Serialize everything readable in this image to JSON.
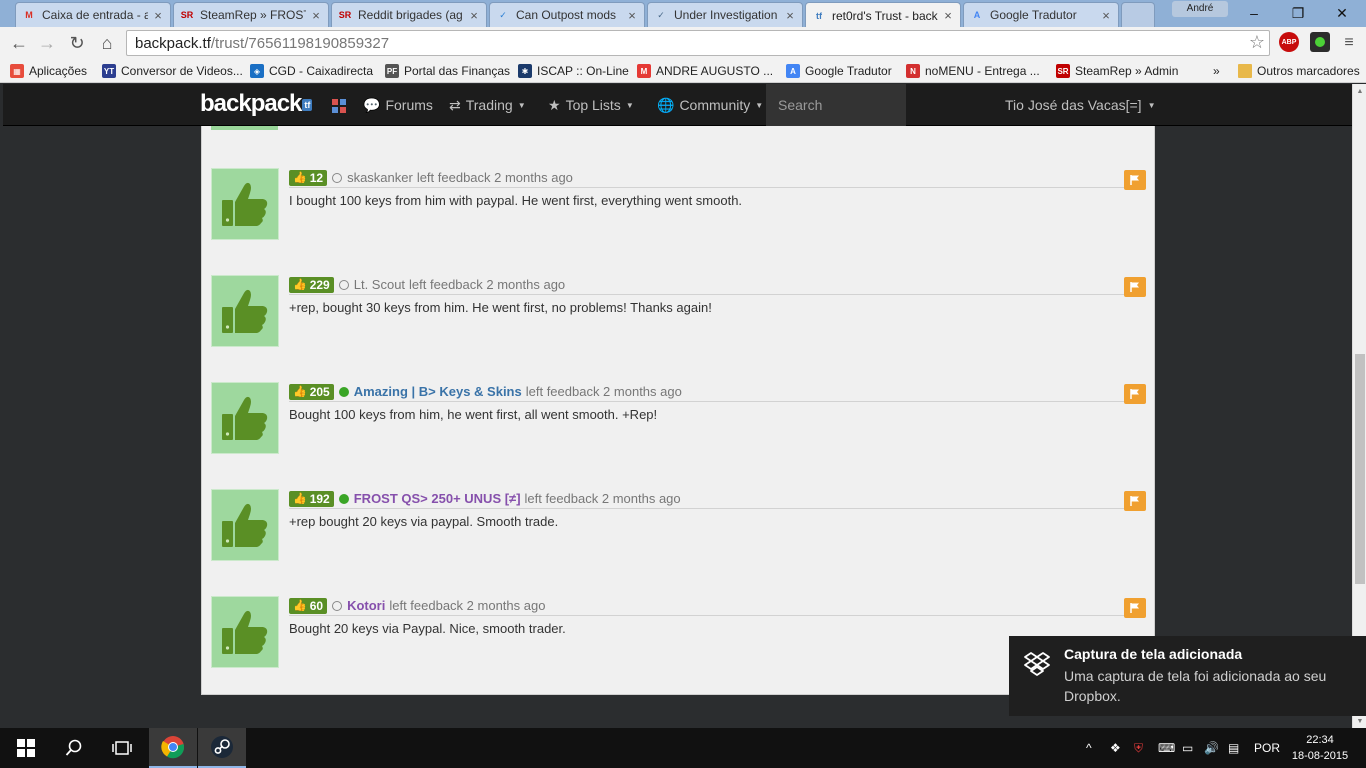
{
  "browser": {
    "tabs": [
      {
        "label": "Caixa de entrada - a",
        "icon": "gmail-icon",
        "fav": "M",
        "color": "#d93025"
      },
      {
        "label": "SteamRep » FROST",
        "icon": "steamrep-icon",
        "fav": "SR",
        "color": "#c00000"
      },
      {
        "label": "Reddit brigades (ag",
        "icon": "steamrep-icon",
        "fav": "SR",
        "color": "#c00000"
      },
      {
        "label": "Can Outpost mods",
        "icon": "outpost-icon",
        "fav": "✓",
        "color": "#2b7fd4"
      },
      {
        "label": "Under Investigation",
        "icon": "outpost-icon",
        "fav": "✓",
        "color": "#4a6a8a"
      },
      {
        "label": "ret0rd's Trust - back",
        "icon": "backpack-icon",
        "fav": "tf",
        "color": "#3e7cbf",
        "active": true
      },
      {
        "label": "Google Tradutor",
        "icon": "google-translate-icon",
        "fav": "A",
        "color": "#4285f4"
      }
    ],
    "profile_name": "André",
    "url_host": "backpack.tf",
    "url_path": "/trust/76561198190859327",
    "extensions": [
      {
        "label": "ABP",
        "color": "#c70d0d"
      },
      {
        "label": "",
        "color": "#2c2c2c"
      }
    ],
    "bookmarks": [
      {
        "label": "Aplicações",
        "icon": "apps-icon",
        "fav": "▦",
        "color": "#e74c3c"
      },
      {
        "label": "Conversor de Videos...",
        "icon": "mp3-icon",
        "fav": "YT",
        "color": "#2c3e90"
      },
      {
        "label": "CGD - Caixadirecta",
        "icon": "cgd-icon",
        "fav": "◈",
        "color": "#1a6fc4"
      },
      {
        "label": "Portal das Finanças",
        "icon": "financas-icon",
        "fav": "PF",
        "color": "#555555"
      },
      {
        "label": "ISCAP :: On-Line",
        "icon": "iscap-icon",
        "fav": "✱",
        "color": "#1b3a6b"
      },
      {
        "label": "ANDRE AUGUSTO ...",
        "icon": "m-icon",
        "fav": "M",
        "color": "#e53935"
      },
      {
        "label": "Google Tradutor",
        "icon": "google-translate-icon",
        "fav": "A",
        "color": "#4285f4"
      },
      {
        "label": "noMENU - Entrega ...",
        "icon": "nomenu-icon",
        "fav": "N",
        "color": "#d32f2f"
      },
      {
        "label": "SteamRep » Admin",
        "icon": "steamrep-icon",
        "fav": "SR",
        "color": "#c00000"
      }
    ],
    "bookmarks_overflow": "»",
    "other_bookmarks": "Outros marcadores"
  },
  "site": {
    "logo": "backpack",
    "logo_badge": "tf",
    "nav": [
      {
        "label": "Forums",
        "icon": "chat-icon",
        "glyph": "💬",
        "caret": false
      },
      {
        "label": "Trading",
        "icon": "exchange-icon",
        "glyph": "⇄",
        "caret": true
      },
      {
        "label": "Top Lists",
        "icon": "star-icon",
        "glyph": "★",
        "caret": true
      },
      {
        "label": "Community",
        "icon": "globe-icon",
        "glyph": "🌐",
        "caret": true
      }
    ],
    "search_placeholder": "Search",
    "user": "Tio José das Vacas[=]"
  },
  "feedback": [
    {
      "rep": "12",
      "online": false,
      "user": "skaskanker",
      "style": "plain",
      "action": "left feedback 2 months ago",
      "message": "I bought 100 keys from him with paypal. He went first, everything went smooth."
    },
    {
      "rep": "229",
      "online": false,
      "user": "Lt. Scout",
      "style": "plain",
      "action": "left feedback 2 months ago",
      "message": "+rep, bought 30 keys from him. He went first, no problems! Thanks again!"
    },
    {
      "rep": "205",
      "online": true,
      "user": "Amazing | B> Keys & Skins",
      "style": "blue",
      "action": "left feedback 2 months ago",
      "message": "Bought 100 keys from him, he went first, all went smooth. +Rep!"
    },
    {
      "rep": "192",
      "online": true,
      "user": "FROST QS> 250+ UNUS [≠]",
      "style": "purple",
      "action": "left feedback 2 months ago",
      "message": "+rep bought 20 keys via paypal. Smooth trade."
    },
    {
      "rep": "60",
      "online": false,
      "user": "Kotori",
      "style": "purple",
      "action": "left feedback 2 months ago",
      "message": "Bought 20 keys via Paypal. Nice, smooth trader."
    }
  ],
  "toast": {
    "title": "Captura de tela adicionada",
    "body": "Uma captura de tela foi adicionada ao seu Dropbox."
  },
  "taskbar": {
    "language": "POR",
    "time": "22:34",
    "date": "18-08-2015"
  },
  "colors": {
    "rep_badge": "#5a8f25",
    "flag": "#f0a030",
    "thumb_bg": "#9ed89e",
    "online": "#3aa526"
  }
}
